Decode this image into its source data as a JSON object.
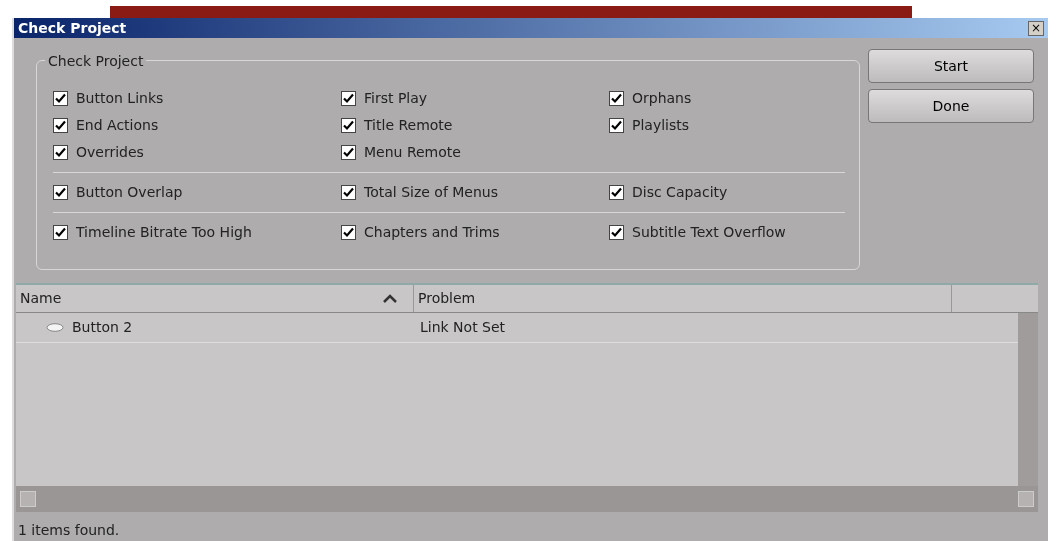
{
  "window": {
    "title": "Check Project",
    "close": "×"
  },
  "group": {
    "title": "Check Project",
    "sections": [
      {
        "columns": [
          [
            {
              "label": "Button Links",
              "checked": true
            },
            {
              "label": "End Actions",
              "checked": true
            },
            {
              "label": "Overrides",
              "checked": true
            }
          ],
          [
            {
              "label": "First Play",
              "checked": true
            },
            {
              "label": "Title Remote",
              "checked": true
            },
            {
              "label": "Menu Remote",
              "checked": true
            }
          ],
          [
            {
              "label": "Orphans",
              "checked": true
            },
            {
              "label": "Playlists",
              "checked": true
            }
          ]
        ]
      },
      {
        "columns": [
          [
            {
              "label": "Button Overlap",
              "checked": true
            }
          ],
          [
            {
              "label": "Total Size of Menus",
              "checked": true
            }
          ],
          [
            {
              "label": "Disc Capacity",
              "checked": true
            }
          ]
        ]
      },
      {
        "columns": [
          [
            {
              "label": "Timeline Bitrate Too High",
              "checked": true
            }
          ],
          [
            {
              "label": "Chapters and Trims",
              "checked": true
            }
          ],
          [
            {
              "label": "Subtitle Text Overflow",
              "checked": true
            }
          ]
        ]
      }
    ]
  },
  "buttons": [
    "Start",
    "Done"
  ],
  "table": {
    "columns": [
      "Name",
      "Problem"
    ],
    "rows": [
      {
        "name": "Button 2",
        "problem": "Link Not Set"
      }
    ]
  },
  "status_bar": "1 items found."
}
